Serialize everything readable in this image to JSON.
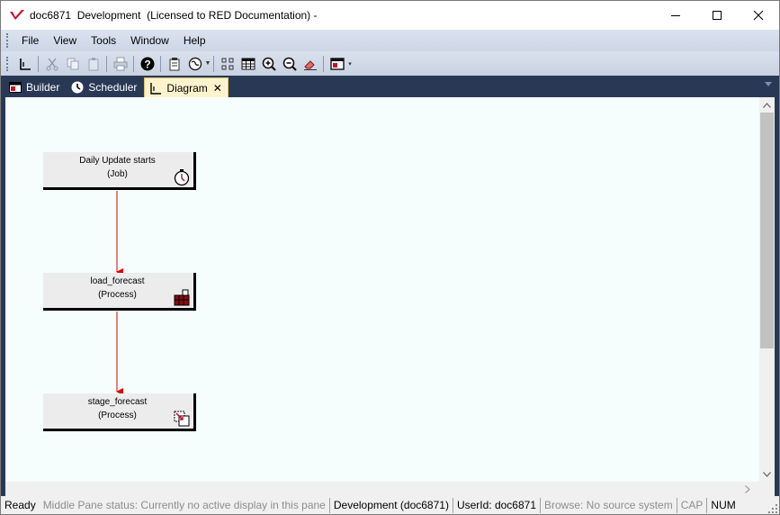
{
  "window": {
    "title": "doc6871  Development  (Licensed to RED Documentation) -"
  },
  "menu": {
    "items": [
      "File",
      "View",
      "Tools",
      "Window",
      "Help"
    ]
  },
  "toolbar": {
    "icons": [
      "new-icon",
      "cut-icon",
      "copy-icon",
      "paste-icon",
      "print-icon",
      "help-icon",
      "clipboard-icon",
      "globe-icon",
      "layout-icon",
      "grid-icon",
      "zoom-in-icon",
      "zoom-out-icon",
      "eraser-icon",
      "window-icon"
    ]
  },
  "tabs": [
    {
      "label": "Builder",
      "icon": "builder-icon",
      "active": false
    },
    {
      "label": "Scheduler",
      "icon": "clock-icon",
      "active": false
    },
    {
      "label": "Diagram",
      "icon": "diagram-icon",
      "active": true,
      "closable": true
    }
  ],
  "diagram": {
    "nodes": [
      {
        "title": "Daily Update starts",
        "type": "(Job)",
        "icon": "stopwatch-icon"
      },
      {
        "title": "load_forecast",
        "type": "(Process)",
        "icon": "load-table-icon"
      },
      {
        "title": "stage_forecast",
        "type": "(Process)",
        "icon": "stage-table-icon"
      }
    ],
    "connector_color": "#e00000"
  },
  "statusbar": {
    "ready": "Ready",
    "middle_pane": "Middle Pane status: Currently no active display in this pane",
    "repository": "Development (doc6871)",
    "user": "UserId: doc6871",
    "browse": "Browse: No source system",
    "cap": "CAP",
    "num": "NUM"
  },
  "colors": {
    "tabstrip": "#293955",
    "canvas": "#f5fdfd",
    "active_tab": "#fff3cd",
    "accent_red": "#c8102e"
  }
}
